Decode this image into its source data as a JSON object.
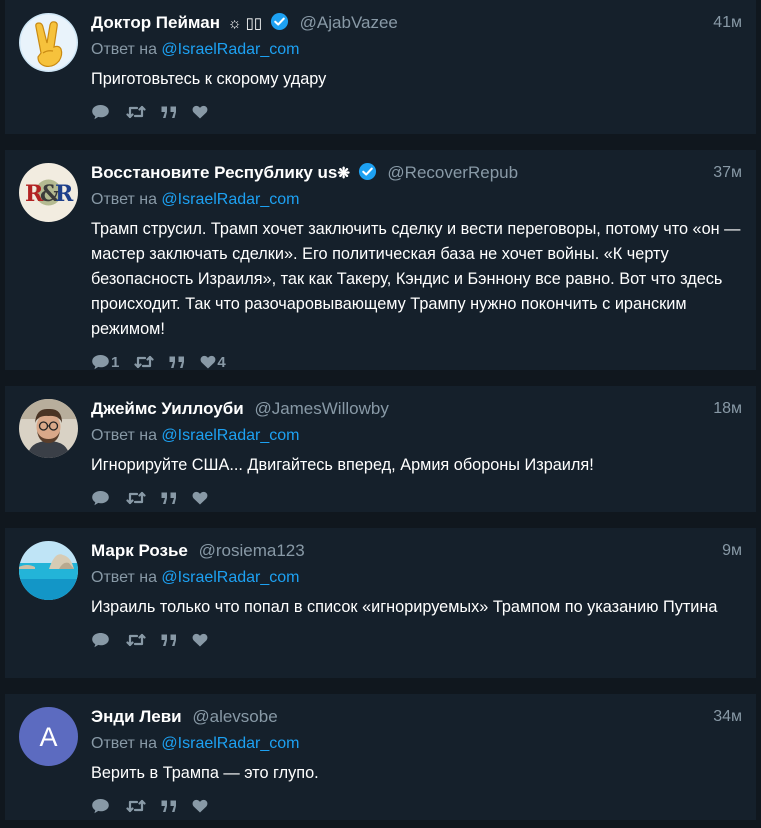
{
  "tweets": [
    {
      "name": "Доктор Пейман",
      "name_extra": "☼ ▯▯",
      "verified": true,
      "handle": "@AjabVazee",
      "time": "41м",
      "reply_prefix": "Ответ на",
      "reply_to": "@IsraelRadar_com",
      "text": "Приготовьтесь к скорому удару",
      "reply_count": "",
      "like_count": "",
      "avatar": "victory-hand-avatar"
    },
    {
      "name": "Восстановите Республику us",
      "name_extra": "❋",
      "verified": true,
      "handle": "@RecoverRepub",
      "time": "37м",
      "reply_prefix": "Ответ на",
      "reply_to": "@IsraelRadar_com",
      "text": "Трамп струсил. Трамп хочет заключить сделку и вести переговоры, потому что «он — мастер заключать сделки». Его политическая база не хочет войны. «К черту безопасность Израиля», так как Такеру, Кэндис и Бэннону все равно. Вот что здесь происходит. Так что разочаровывающему Трампу нужно покончить с иранским режимом!",
      "reply_count": "1",
      "like_count": "4",
      "avatar": "rr-logo-avatar"
    },
    {
      "name": "Джеймс Уиллоуби",
      "name_extra": "",
      "verified": false,
      "handle": "@JamesWillowby",
      "time": "18м",
      "reply_prefix": "Ответ на",
      "reply_to": "@IsraelRadar_com",
      "text": "Игнорируйте США... Двигайтесь вперед, Армия обороны Израиля!",
      "reply_count": "",
      "like_count": "",
      "avatar": "man-photo-avatar"
    },
    {
      "name": "Марк Розье",
      "name_extra": "",
      "verified": false,
      "handle": "@rosiema123",
      "time": "9м",
      "reply_prefix": "Ответ на",
      "reply_to": "@IsraelRadar_com",
      "text": "Израиль только что попал в список «игнорируемых» Трампом по указанию Путина",
      "reply_count": "",
      "like_count": "",
      "avatar": "beach-photo-avatar"
    },
    {
      "name": "Энди Леви",
      "name_extra": "",
      "verified": false,
      "handle": "@alevsobe",
      "time": "34м",
      "reply_prefix": "Ответ на",
      "reply_to": "@IsraelRadar_com",
      "text": "Верить в Трампа — это глупо.",
      "reply_count": "",
      "like_count": "",
      "avatar": "letter-avatar",
      "avatar_letter": "A"
    }
  ],
  "colors": {
    "background": "#10171e",
    "card": "#15202b",
    "link": "#1da1f2",
    "muted": "#8899a6",
    "verified": "#1da1f2",
    "letter_avatar": "#5c6bc0"
  }
}
